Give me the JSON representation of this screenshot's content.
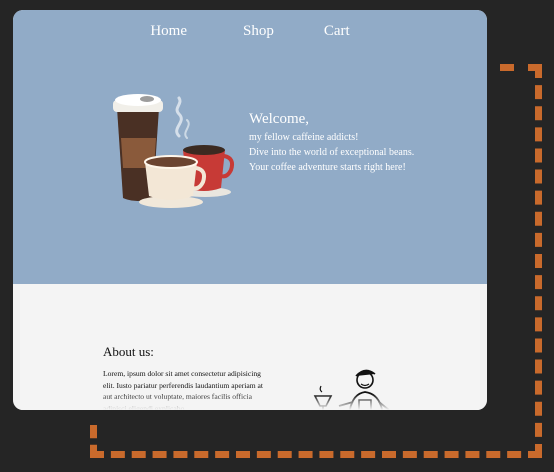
{
  "nav": {
    "items": [
      {
        "label": "Home"
      },
      {
        "label": "Shop"
      },
      {
        "label": "Cart"
      }
    ]
  },
  "hero": {
    "heading": "Welcome,",
    "lines": [
      "my fellow caffeine addicts!",
      "Dive into the world of exceptional beans.",
      "Your coffee adventure starts right here!"
    ]
  },
  "about": {
    "heading": "About us:",
    "body": "Lorem, ipsum dolor sit amet consectetur adipisicing elit. Iusto pariatur perferendis laudantium aperiam at aut architecto ut voluptate, maiores facilis officia adipisci eligendi explicabo,"
  },
  "colors": {
    "hero_bg": "#91abc7",
    "page_bg": "#f4f4f4",
    "frame_accent": "#c96a2c"
  }
}
